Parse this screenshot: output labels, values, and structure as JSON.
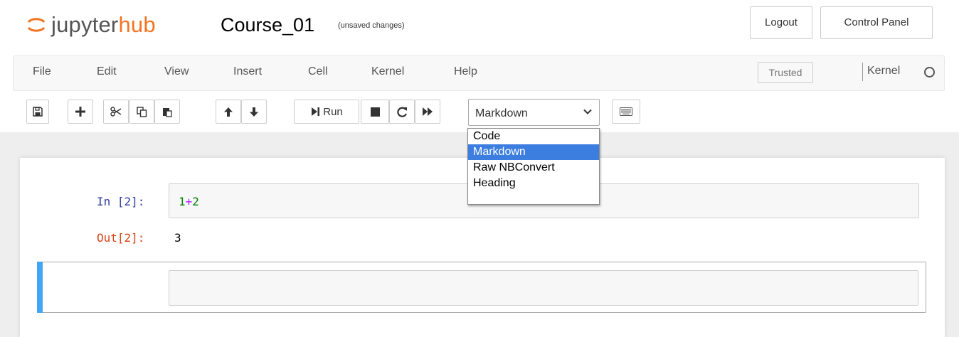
{
  "header": {
    "logo_jupyter": "jupyter",
    "logo_hub": "hub",
    "notebook_name": "Course_01",
    "save_status": "(unsaved changes)",
    "logout_label": "Logout",
    "control_panel_label": "Control Panel"
  },
  "menubar": {
    "items": [
      "File",
      "Edit",
      "View",
      "Insert",
      "Cell",
      "Kernel",
      "Help"
    ],
    "trusted_label": "Trusted",
    "kernel_label": "Kernel",
    "kernel_indicator": "kernel-idle-icon"
  },
  "toolbar": {
    "icons": [
      "save-icon",
      "plus-icon",
      "cut-icon",
      "copy-icon",
      "paste-icon",
      "arrow-up-icon",
      "arrow-down-icon",
      "step-forward-icon",
      "stop-icon",
      "restart-icon",
      "fast-forward-icon",
      "keyboard-icon"
    ],
    "run_label": "Run",
    "cell_type": {
      "selected": "Markdown",
      "options": [
        "Code",
        "Markdown",
        "Raw NBConvert",
        "Heading"
      ],
      "highlighted": "Markdown"
    }
  },
  "notebook": {
    "cells": [
      {
        "in_prompt": "In [2]:",
        "code_tokens": [
          "1",
          "+",
          "2"
        ],
        "out_prompt": "Out[2]:",
        "output": "3"
      },
      {
        "in_prompt": "",
        "code": "",
        "selected": true
      }
    ]
  },
  "colors": {
    "brand_orange": "#f37524",
    "selection_blue": "#3c7ee0",
    "active_cell_bar": "#42a5f5",
    "in_prompt": "#303f9f",
    "out_prompt": "#d84315"
  }
}
